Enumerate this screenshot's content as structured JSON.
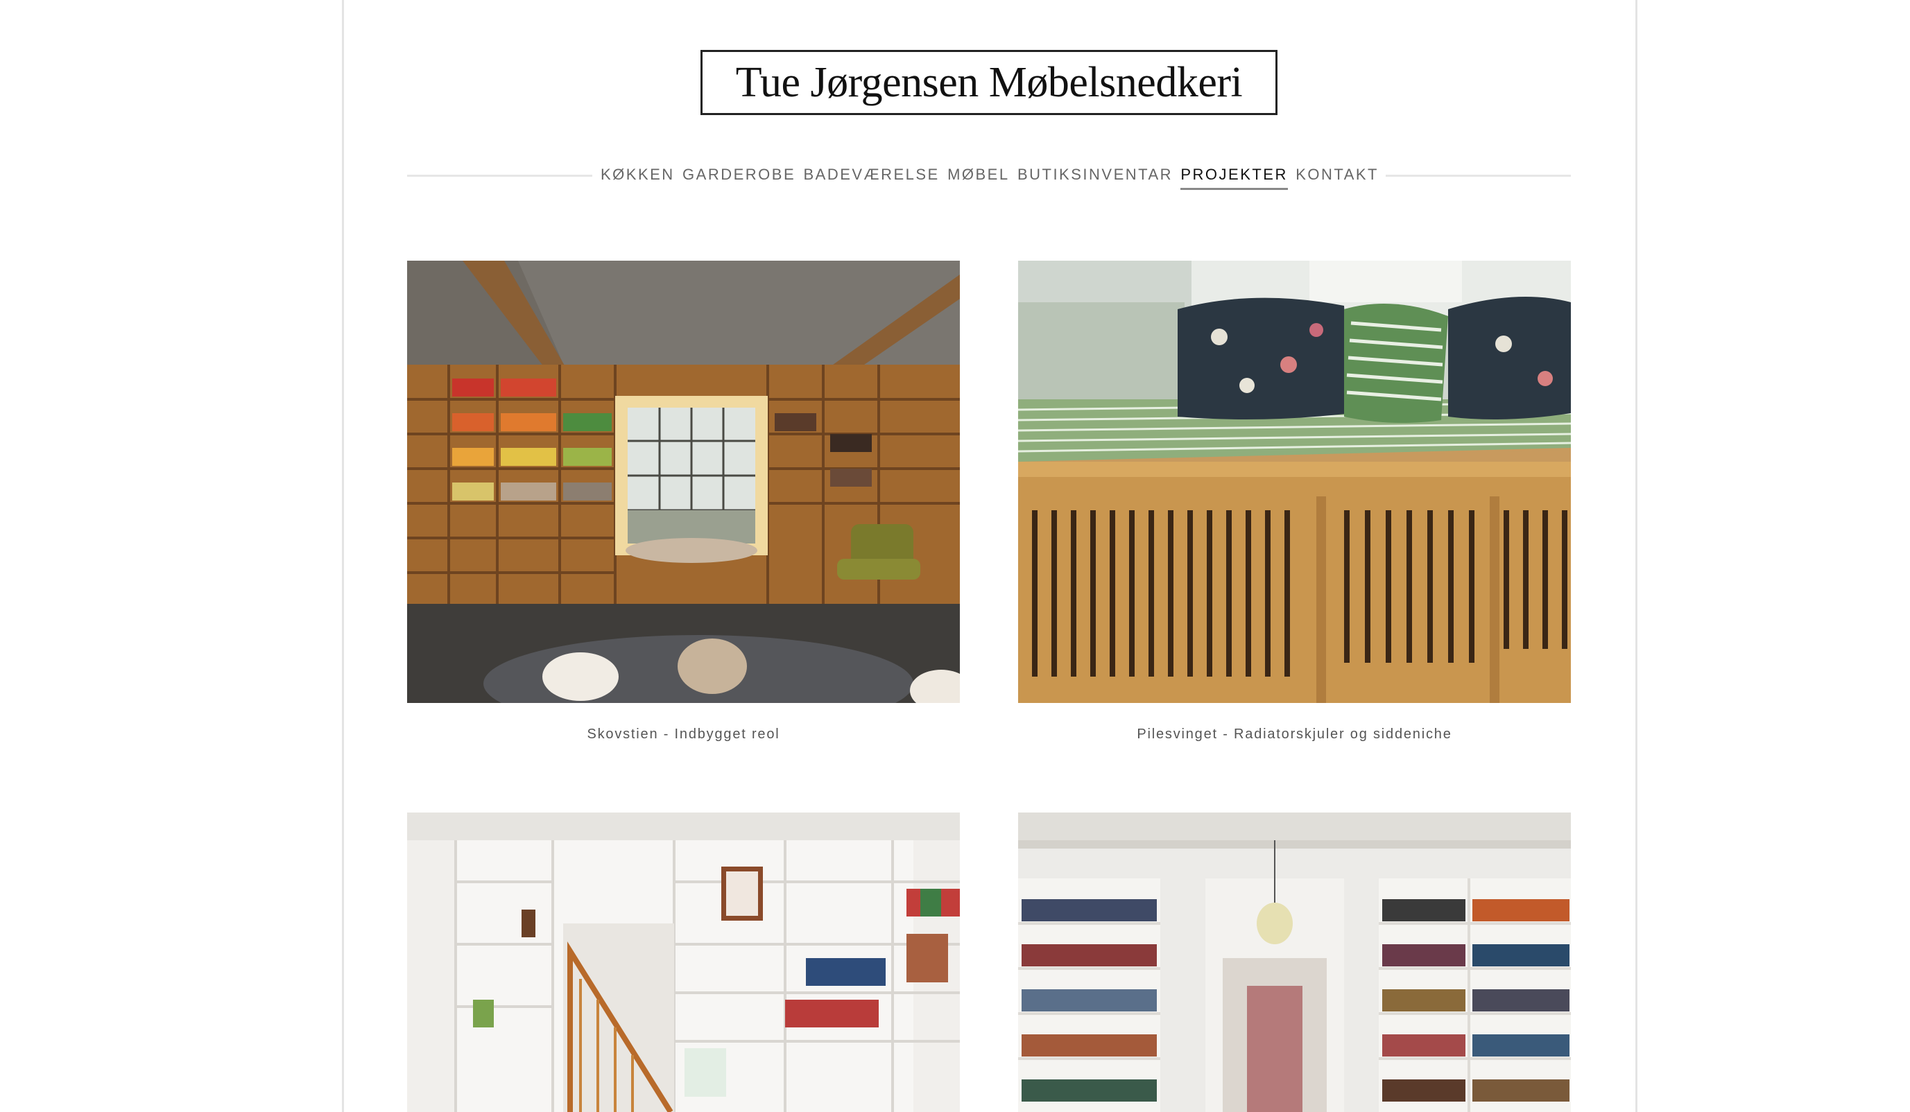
{
  "site": {
    "logo_text": "Tue Jørgensen Møbelsnedkeri"
  },
  "nav": {
    "items": [
      {
        "label": "KØKKEN",
        "active": false
      },
      {
        "label": "GARDEROBE",
        "active": false
      },
      {
        "label": "BADEVÆRELSE",
        "active": false
      },
      {
        "label": "MØBEL",
        "active": false
      },
      {
        "label": "BUTIKSINVENTAR",
        "active": false
      },
      {
        "label": "PROJEKTER",
        "active": true
      },
      {
        "label": "KONTAKT",
        "active": false
      }
    ]
  },
  "projects": [
    {
      "caption": "Skovstien - Indbygget reol"
    },
    {
      "caption": "Pilesvinget - Radiatorskjuler og siddeniche"
    },
    {
      "caption": ""
    },
    {
      "caption": ""
    }
  ],
  "colors": {
    "text": "#333333",
    "nav_text": "#666666",
    "nav_active": "#111111",
    "frame_border": "#e4e4e4"
  }
}
